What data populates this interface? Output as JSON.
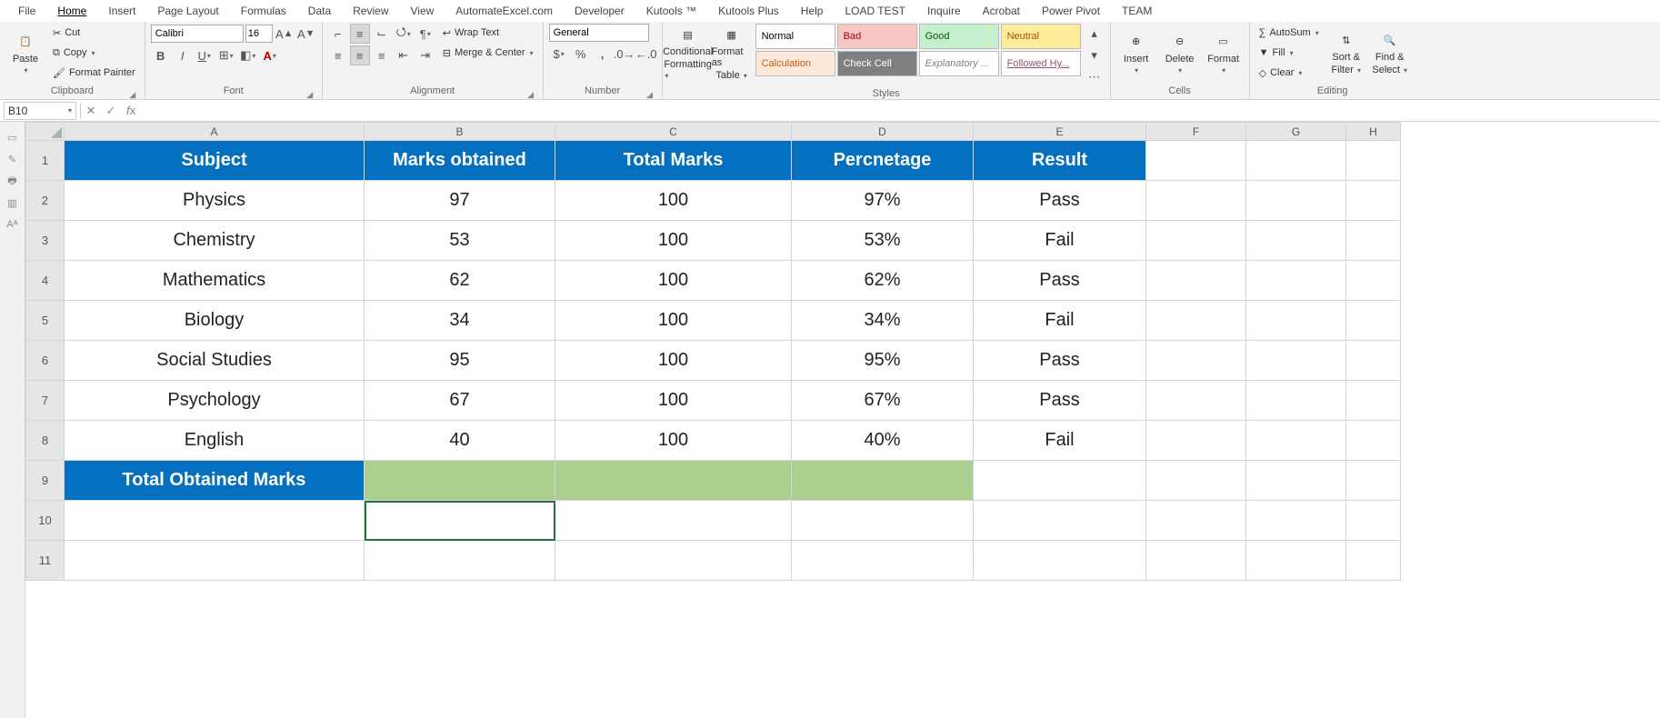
{
  "ribbon": {
    "tabs": [
      "File",
      "Home",
      "Insert",
      "Page Layout",
      "Formulas",
      "Data",
      "Review",
      "View",
      "AutomateExcel.com",
      "Developer",
      "Kutools ™",
      "Kutools Plus",
      "Help",
      "LOAD TEST",
      "Inquire",
      "Acrobat",
      "Power Pivot",
      "TEAM"
    ],
    "active_tab": "Home",
    "clipboard": {
      "paste": "Paste",
      "cut": "Cut",
      "copy": "Copy",
      "format_painter": "Format Painter",
      "group_label": "Clipboard"
    },
    "font": {
      "name": "Calibri",
      "size": "16",
      "group_label": "Font"
    },
    "alignment": {
      "wrap": "Wrap Text",
      "merge": "Merge & Center",
      "group_label": "Alignment"
    },
    "number": {
      "format": "General",
      "group_label": "Number"
    },
    "styles": {
      "cond": "Conditional Formatting",
      "cond_l1": "Conditional",
      "cond_l2": "Formatting",
      "table": "Format as Table",
      "table_l1": "Format as",
      "table_l2": "Table",
      "chips": [
        {
          "label": "Normal",
          "bg": "#ffffff",
          "fg": "#000"
        },
        {
          "label": "Bad",
          "bg": "#f8c7c4",
          "fg": "#9c0006"
        },
        {
          "label": "Good",
          "bg": "#c6efce",
          "fg": "#006100"
        },
        {
          "label": "Neutral",
          "bg": "#ffeb9c",
          "fg": "#9c5700"
        },
        {
          "label": "Calculation",
          "bg": "#fde9d9",
          "fg": "#c65911"
        },
        {
          "label": "Check Cell",
          "bg": "#808080",
          "fg": "#ffffff"
        },
        {
          "label": "Explanatory ...",
          "bg": "#ffffff",
          "fg": "#7f7f7f",
          "italic": true
        },
        {
          "label": "Followed Hy...",
          "bg": "#ffffff",
          "fg": "#954f72",
          "underline": true
        }
      ],
      "group_label": "Styles"
    },
    "cells": {
      "insert": "Insert",
      "delete": "Delete",
      "format": "Format",
      "group_label": "Cells"
    },
    "editing": {
      "autosum": "AutoSum",
      "fill": "Fill",
      "clear": "Clear",
      "sort": "Sort & Filter",
      "sort_l1": "Sort &",
      "sort_l2": "Filter",
      "find": "Find & Select",
      "find_l1": "Find &",
      "find_l2": "Select",
      "group_label": "Editing"
    }
  },
  "namebox": "B10",
  "formula": "",
  "columns": [
    "A",
    "B",
    "C",
    "D",
    "E",
    "F",
    "G",
    "H"
  ],
  "sheet": {
    "headers": [
      "Subject",
      "Marks obtained",
      "Total Marks",
      "Percnetage",
      "Result"
    ],
    "rows": [
      {
        "subject": "Physics",
        "marks": "97",
        "total": "100",
        "pct": "97%",
        "result": "Pass"
      },
      {
        "subject": "Chemistry",
        "marks": "53",
        "total": "100",
        "pct": "53%",
        "result": "Fail"
      },
      {
        "subject": "Mathematics",
        "marks": "62",
        "total": "100",
        "pct": "62%",
        "result": "Pass"
      },
      {
        "subject": "Biology",
        "marks": "34",
        "total": "100",
        "pct": "34%",
        "result": "Fail"
      },
      {
        "subject": "Social Studies",
        "marks": "95",
        "total": "100",
        "pct": "95%",
        "result": "Pass"
      },
      {
        "subject": "Psychology",
        "marks": "67",
        "total": "100",
        "pct": "67%",
        "result": "Pass"
      },
      {
        "subject": "English",
        "marks": "40",
        "total": "100",
        "pct": "40%",
        "result": "Fail"
      }
    ],
    "total_label": "Total Obtained Marks"
  }
}
